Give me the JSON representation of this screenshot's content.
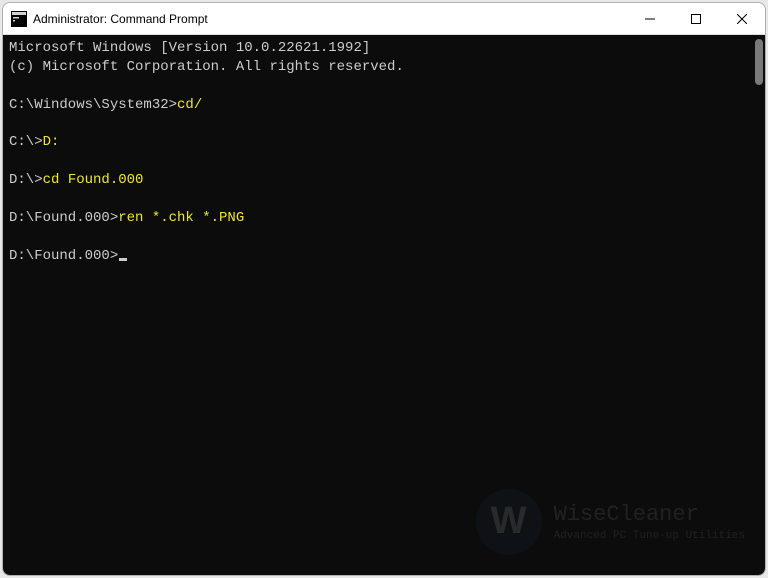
{
  "window": {
    "title": "Administrator: Command Prompt"
  },
  "terminal": {
    "header_line1": "Microsoft Windows [Version 10.0.22621.1992]",
    "header_line2": "(c) Microsoft Corporation. All rights reserved.",
    "entries": [
      {
        "prompt": "C:\\Windows\\System32>",
        "command": "cd/",
        "highlight": true
      },
      {
        "prompt": "C:\\>",
        "command": "D:",
        "highlight": true
      },
      {
        "prompt": "D:\\>",
        "command": "cd Found.000",
        "highlight": true
      },
      {
        "prompt": "D:\\Found.000>",
        "command": "ren *.chk *.PNG",
        "highlight": true
      }
    ],
    "final_prompt": "D:\\Found.000>"
  },
  "watermark": {
    "badge_letter": "W",
    "title": "WiseCleaner",
    "subtitle": "Advanced PC Tune-up Utilities"
  }
}
